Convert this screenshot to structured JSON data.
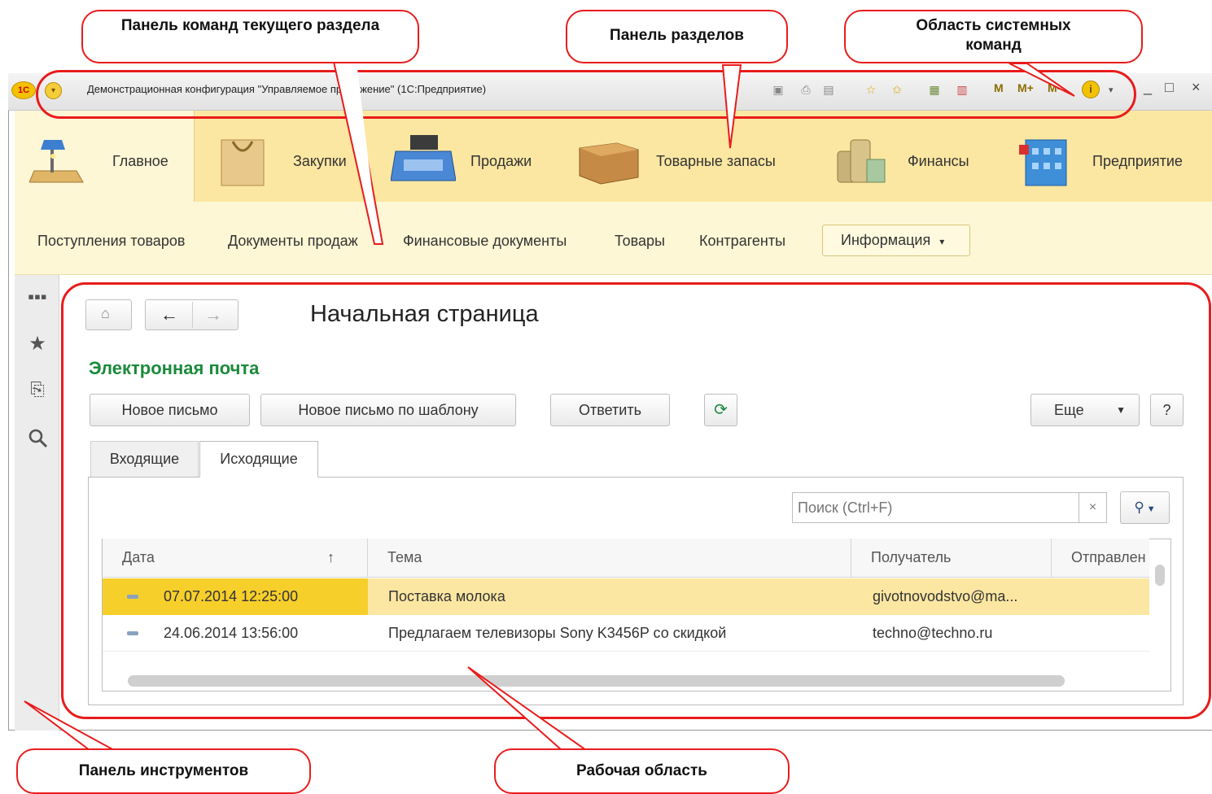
{
  "window": {
    "title": "Демонстрационная конфигурация \"Управляемое приложение\"  (1С:Предприятие)",
    "logo_text": "1С",
    "system_m": [
      "M",
      "M+",
      "M-"
    ],
    "controls": [
      "_",
      "□",
      "×"
    ]
  },
  "sections": [
    {
      "label": "Главное",
      "icon": "desk-lamp-icon"
    },
    {
      "label": "Закупки",
      "icon": "shopping-bag-icon"
    },
    {
      "label": "Продажи",
      "icon": "cash-register-icon"
    },
    {
      "label": "Товарные запасы",
      "icon": "box-icon"
    },
    {
      "label": "Финансы",
      "icon": "coins-icon"
    },
    {
      "label": "Предприятие",
      "icon": "building-icon"
    }
  ],
  "commands": [
    "Поступления товаров",
    "Документы продаж",
    "Финансовые документы",
    "Товары",
    "Контрагенты"
  ],
  "info_menu": {
    "label": "Информация",
    "arrow": "▾"
  },
  "toolbar_icons": [
    "apps-grid-icon",
    "star-icon",
    "history-icon",
    "search-icon"
  ],
  "workspace": {
    "page_title": "Начальная страница",
    "group_title": "Электронная почта",
    "buttons": {
      "new_letter": "Новое письмо",
      "new_by_template": "Новое письмо по шаблону",
      "reply": "Ответить",
      "more": "Еще",
      "help": "?"
    },
    "tabs": [
      "Входящие",
      "Исходящие"
    ],
    "search_placeholder": "Поиск (Ctrl+F)",
    "table": {
      "columns": [
        "Дата",
        "Тема",
        "Получатель",
        "Отправлен"
      ],
      "sort_indicator": "↑",
      "rows": [
        {
          "date": "07.07.2014 12:25:00",
          "subject": "Поставка молока",
          "recipient": "givotnovodstvo@ma..."
        },
        {
          "date": "24.06.2014 13:56:00",
          "subject": "Предлагаем телевизоры Sony K3456P со скидкой",
          "recipient": "techno@techno.ru"
        }
      ]
    }
  },
  "callouts": {
    "command_panel": "Панель команд текущего раздела",
    "sections_panel": "Панель разделов",
    "system_commands": "Область системных команд",
    "tools_panel": "Панель инструментов",
    "work_area": "Рабочая область"
  },
  "colors": {
    "accent_red": "#e81c1c",
    "section_bg": "#fbe7a2",
    "active_bg": "#fdf7d6",
    "group_title": "#1a8a3a",
    "selected_row": "#fbe7a2"
  }
}
